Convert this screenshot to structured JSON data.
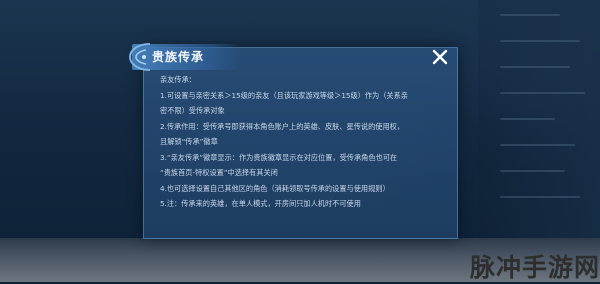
{
  "dialog": {
    "title": "贵族传承",
    "close_icon": "close-x-icon",
    "lines": [
      "亲友传承：",
      "1.可设置与亲密关系＞15级的亲友（且该玩家游戏等级＞15级）作为（关系亲",
      "密不限）受传承对象",
      "2.传承作用：受传承号即获得本角色账户上的英雄、皮肤、星传说的使用权，",
      "且解锁“传承”徽章",
      "3.“亲友传承”徽章显示：作为贵族徽章显示在对应位置，受传承角色也可在",
      "“贵族首页-特权设置”中选择有其关闭",
      "4.也可选择设置自己其他区的角色（消耗领取号传承的设置与使用规则）",
      "5.注：传承来的英雄，在单人模式，开房间只加人机时不可使用"
    ]
  },
  "watermark": "脉冲手游网"
}
